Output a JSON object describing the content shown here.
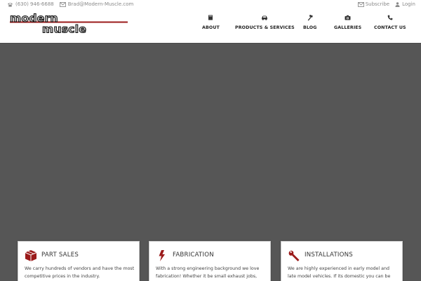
{
  "topbar": {
    "phone": "(630) 946-6688",
    "email": "Brad@Modern-Muscle.com",
    "subscribe": "Subscribe",
    "login": "Login"
  },
  "logo": {
    "line1": "modern",
    "line2": "muscle"
  },
  "nav": [
    {
      "label": "ABOUT",
      "icon": "book-icon"
    },
    {
      "label": "PRODUCTS & SERVICES",
      "icon": "car-icon"
    },
    {
      "label": "BLOG",
      "icon": "hammer-icon"
    },
    {
      "label": "GALLERIES",
      "icon": "camera-icon"
    },
    {
      "label": "CONTACT US",
      "icon": "phone-icon"
    }
  ],
  "hero": {
    "color": "#565656"
  },
  "cards": [
    {
      "title": "PART SALES",
      "icon": "box-icon",
      "body": "We carry hundreds of vendors and have the most competitive prices in the industry."
    },
    {
      "title": "FABRICATION",
      "icon": "lightning-icon",
      "body": "With a strong engineering background we love fabrication!  Whether it be small exhaust jobs,"
    },
    {
      "title": "INSTALLATIONS",
      "icon": "wrench-icon",
      "body": "We are highly experienced in early model and late model vehicles.  If its domestic you can be"
    }
  ],
  "colors": {
    "accent_red": "#9b1b1b",
    "text_dark": "#222222",
    "muted": "#8a8a8a"
  }
}
